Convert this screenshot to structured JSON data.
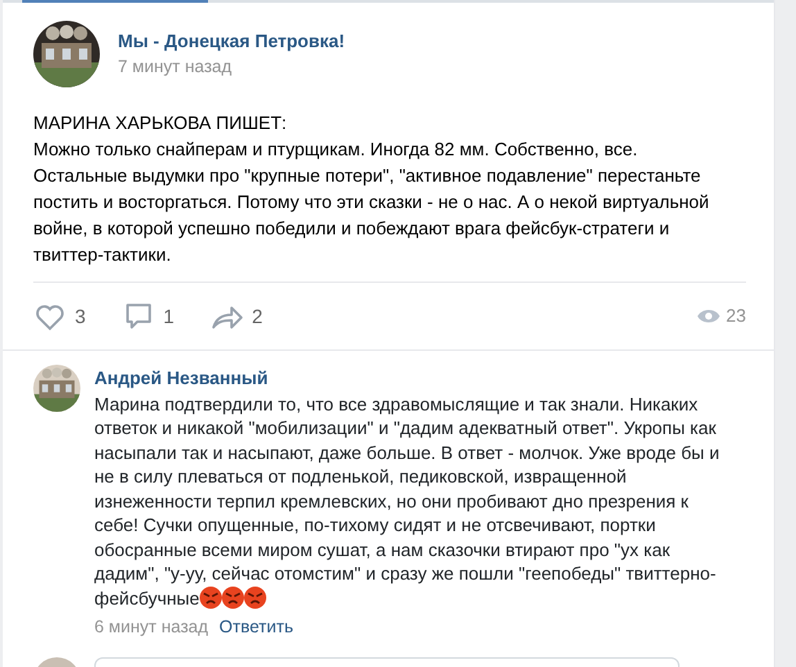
{
  "post": {
    "author": "Мы - Донецкая Петровка!",
    "time": "7 минут назад",
    "title": "МАРИНА ХАРЬКОВА ПИШЕТ:",
    "text": "Можно только снайперам и птурщикам. Иногда 82 мм. Собственно, все. Остальные выдумки про \"крупные потери\", \"активное подавление\" перестаньте постить и восторгаться. Потому что эти сказки - не о нас. А о некой виртуальной войне, в которой успешно победили и побеждают врага фейсбук-стратеги и твиттер-тактики.",
    "actions": [
      {
        "kind": "like",
        "count": "3"
      },
      {
        "kind": "comment",
        "count": "1"
      },
      {
        "kind": "share",
        "count": "2"
      }
    ],
    "views": "23"
  },
  "comment": {
    "author": "Андрей Незванный",
    "text": "Марина подтвердили то, что все здравомыслящие и так знали. Никаких ответок и никакой \"мобилизации\" и \"дадим адекватный ответ\". Укропы как насыпали так и насыпают, даже больше. В ответ - молчок. Уже вроде бы и не в силу плеваться от подленькой, педиковской, извращенной изнеженности терпил кремлевских, но они пробивают дно презрения к себе! Сучки опущенные, по-тихому сидят и не отсвечивают, портки обосранные всеми миром сушат, а нам сказочки втирают про \"ух как дадим\", \"у-уу, сейчас отомстим\" и сразу же пошли \"геепобеды\" твиттерно-фейсбучные",
    "emoji": [
      {
        "kind": "angry"
      },
      {
        "kind": "angry"
      },
      {
        "kind": "angry"
      }
    ],
    "time": "6 минут назад",
    "reply": "Ответить"
  }
}
